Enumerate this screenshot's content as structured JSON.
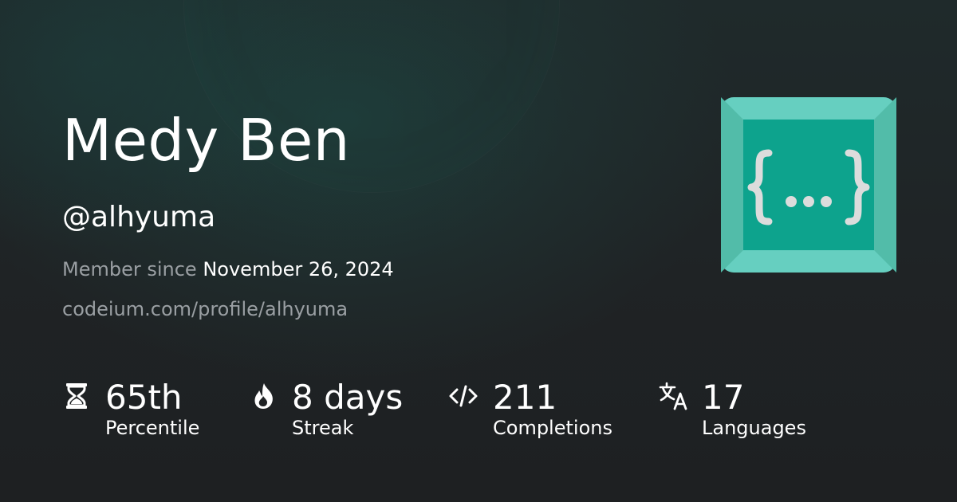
{
  "profile": {
    "name": "Medy Ben",
    "handle": "@alhyuma",
    "member_since_label": "Member since",
    "member_since_date": "November 26, 2024",
    "url": "codeium.com/profile/alhyuma"
  },
  "logo": {
    "icon": "curly-braces-ellipsis-icon",
    "colors": {
      "outer": "#66cfc0",
      "bevel_side": "#52bca9",
      "inner": "#0da38d",
      "glyph": "#dcdcdc"
    }
  },
  "stats": [
    {
      "icon": "hourglass-icon",
      "value": "65th",
      "label": "Percentile"
    },
    {
      "icon": "flame-icon",
      "value": "8 days",
      "label": "Streak"
    },
    {
      "icon": "code-icon",
      "value": "211",
      "label": "Completions"
    },
    {
      "icon": "translate-icon",
      "value": "17",
      "label": "Languages"
    }
  ],
  "colors": {
    "background": "#1f2123",
    "text_primary": "#ffffff",
    "text_secondary": "#9a9fa3",
    "accent": "#0da38d"
  }
}
